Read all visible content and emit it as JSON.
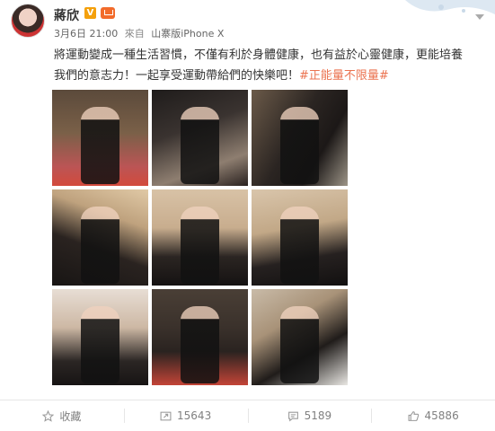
{
  "post": {
    "author": "蔣欣",
    "verified_mark": "V",
    "meta": {
      "date": "3月6日 21:00",
      "source_prefix": "來自",
      "source": "山寨版iPhone X"
    },
    "text_line1": "將運動變成一種生活習慣，不僅有利於身體健康，也有益於心靈健康，更能培養",
    "text_line2": "我們的意志力！一起享受運動帶給們的快樂吧！",
    "hashtag": "#正能量不限量#"
  },
  "photos": [
    {
      "icon": "photo-gym-mirror-selfie-1"
    },
    {
      "icon": "photo-gym-mirror-selfie-2"
    },
    {
      "icon": "photo-gym-mirror-selfie-3"
    },
    {
      "icon": "photo-closeup-selfie-1"
    },
    {
      "icon": "photo-closeup-selfie-2"
    },
    {
      "icon": "photo-closeup-selfie-3"
    },
    {
      "icon": "photo-closeup-selfie-4"
    },
    {
      "icon": "photo-gym-mirror-selfie-4"
    },
    {
      "icon": "photo-gym-mirror-selfie-5"
    }
  ],
  "actions": {
    "favorite": "收藏",
    "repost": "15643",
    "comment": "5189",
    "like": "45886"
  },
  "colors": {
    "hashtag": "#eb7350",
    "verified": "#f4a00b",
    "member": "#f26b2b"
  }
}
